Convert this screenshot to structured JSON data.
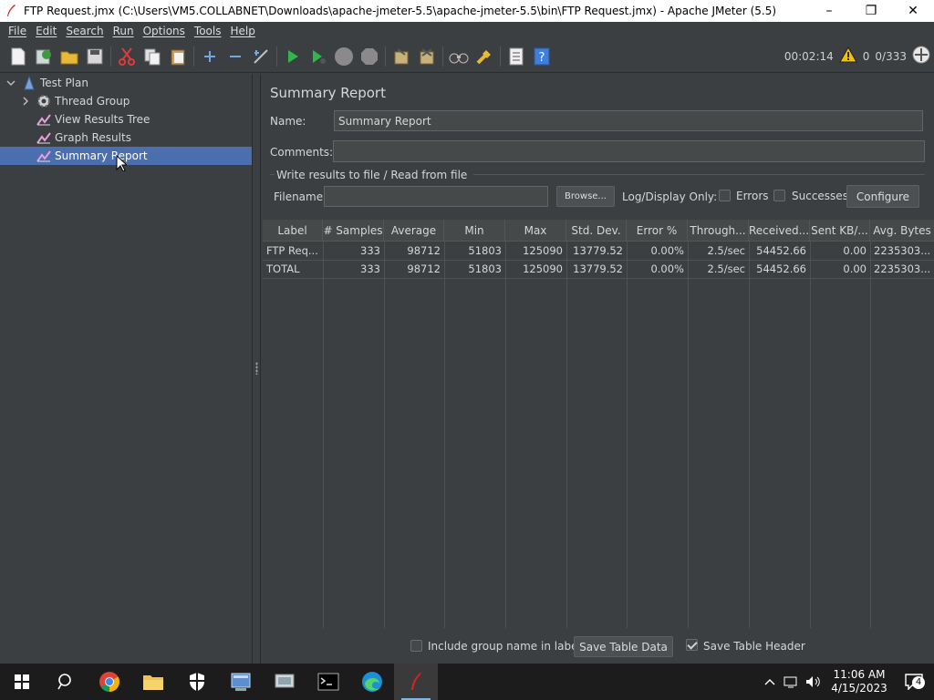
{
  "window": {
    "title": "FTP Request.jmx (C:\\Users\\VM5.COLLABNET\\Downloads\\apache-jmeter-5.5\\apache-jmeter-5.5\\bin\\FTP Request.jmx) - Apache JMeter (5.5)",
    "minimize": "–",
    "maximize": "❐",
    "close": "✕"
  },
  "menu": [
    "File",
    "Edit",
    "Search",
    "Run",
    "Options",
    "Tools",
    "Help"
  ],
  "toolbar": {
    "elapsed": "00:02:14",
    "warnings": "0",
    "threads": "0/333"
  },
  "tree": {
    "items": [
      {
        "label": "Test Plan",
        "icon": "test-plan-icon"
      },
      {
        "label": "Thread Group",
        "icon": "gear-icon"
      },
      {
        "label": "View Results Tree",
        "icon": "chart-icon"
      },
      {
        "label": "Graph Results",
        "icon": "chart-icon"
      },
      {
        "label": "Summary Report",
        "icon": "chart-icon"
      }
    ]
  },
  "panel": {
    "heading": "Summary Report",
    "name_label": "Name:",
    "name_value": "Summary Report",
    "comments_label": "Comments:",
    "comments_value": "",
    "fieldset_title": "Write results to file / Read from file",
    "filename_label": "Filename",
    "filename_value": "",
    "browse": "Browse...",
    "log_display": "Log/Display Only:",
    "errors": "Errors",
    "successes": "Successes",
    "configure": "Configure"
  },
  "table": {
    "columns": [
      "Label",
      "# Samples",
      "Average",
      "Min",
      "Max",
      "Std. Dev.",
      "Error %",
      "Through...",
      "Received...",
      "Sent KB/...",
      "Avg. Bytes"
    ],
    "rows": [
      [
        "FTP Req...",
        "333",
        "98712",
        "51803",
        "125090",
        "13779.52",
        "0.00%",
        "2.5/sec",
        "54452.66",
        "0.00",
        "2235303..."
      ],
      [
        "TOTAL",
        "333",
        "98712",
        "51803",
        "125090",
        "13779.52",
        "0.00%",
        "2.5/sec",
        "54452.66",
        "0.00",
        "2235303..."
      ]
    ]
  },
  "footer": {
    "include_group": "Include group name in label?",
    "save_table_data": "Save Table Data",
    "save_table_header": "Save Table Header"
  },
  "taskbar": {
    "time": "11:06 AM",
    "date": "4/15/2023",
    "notifications": "4"
  },
  "colors": {
    "background": "#3c3f41",
    "selection": "#4b6eaf",
    "taskbar": "#1c1c1c"
  }
}
